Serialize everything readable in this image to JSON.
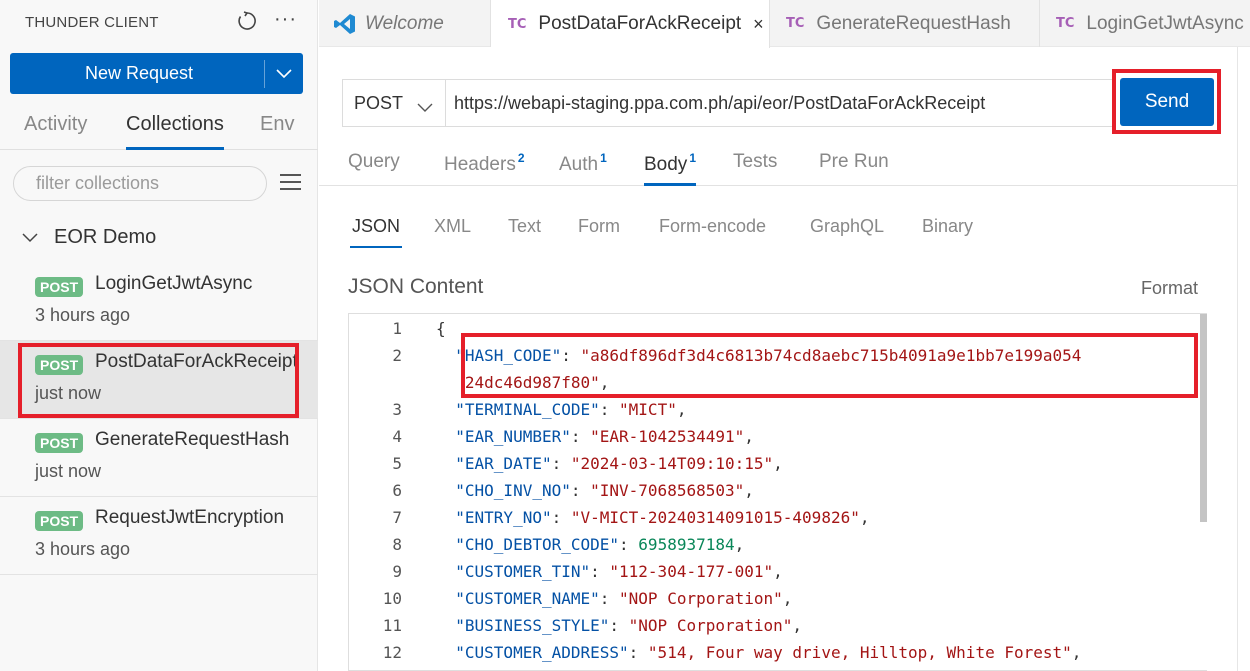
{
  "sidebar": {
    "title": "THUNDER CLIENT",
    "refresh_icon": "refresh-icon",
    "more_icon": "more-icon",
    "more_glyph": "···",
    "new_request_label": "New Request",
    "tabs": [
      {
        "label": "Activity",
        "active": false
      },
      {
        "label": "Collections",
        "active": true
      },
      {
        "label": "Env",
        "active": false
      }
    ],
    "filter_placeholder": "filter collections",
    "collection": {
      "name": "EOR Demo",
      "expanded": true
    },
    "requests": [
      {
        "method": "POST",
        "name": "LoginGetJwtAsync",
        "time": "3 hours ago",
        "selected": false
      },
      {
        "method": "POST",
        "name": "PostDataForAckReceipt",
        "time": "just now",
        "selected": true
      },
      {
        "method": "POST",
        "name": "GenerateRequestHash",
        "time": "just now",
        "selected": false
      },
      {
        "method": "POST",
        "name": "RequestJwtEncryption",
        "time": "3 hours ago",
        "selected": false
      }
    ]
  },
  "editor_tabs": [
    {
      "label": "Welcome",
      "icon": "vscode-icon",
      "active": false
    },
    {
      "label": "PostDataForAckReceipt",
      "icon": "tc",
      "active": true,
      "close": "×"
    },
    {
      "label": "GenerateRequestHash",
      "icon": "tc",
      "active": false
    },
    {
      "label": "LoginGetJwtAsync",
      "icon": "tc",
      "active": false
    }
  ],
  "tc_icon_text": "TC",
  "request": {
    "method": "POST",
    "url": "https://webapi-staging.ppa.com.ph/api/eor/PostDataForAckReceipt",
    "send_label": "Send",
    "tabs": [
      {
        "label": "Query",
        "count": ""
      },
      {
        "label": "Headers",
        "count": "2"
      },
      {
        "label": "Auth",
        "count": "1"
      },
      {
        "label": "Body",
        "count": "1",
        "active": true
      },
      {
        "label": "Tests",
        "count": ""
      },
      {
        "label": "Pre Run",
        "count": ""
      }
    ],
    "body_tabs": [
      "JSON",
      "XML",
      "Text",
      "Form",
      "Form-encode",
      "GraphQL",
      "Binary"
    ],
    "body_active": "JSON",
    "content_label": "JSON Content",
    "format_label": "Format"
  },
  "code_lines": [
    {
      "n": "1",
      "parts": [
        {
          "t": "{",
          "c": "p"
        }
      ]
    },
    {
      "n": "2",
      "parts": [
        {
          "t": "  \"HASH_CODE\"",
          "c": "k"
        },
        {
          "t": ": ",
          "c": "p"
        },
        {
          "t": "\"a86df896df3d4c6813b74cd8aebc715b4091a9e1bb7e199a054",
          "c": "s"
        }
      ]
    },
    {
      "n": "",
      "parts": [
        {
          "t": "   24dc46d987f80\"",
          "c": "s"
        },
        {
          "t": ",",
          "c": "p"
        }
      ]
    },
    {
      "n": "3",
      "parts": [
        {
          "t": "  \"TERMINAL_CODE\"",
          "c": "k"
        },
        {
          "t": ": ",
          "c": "p"
        },
        {
          "t": "\"MICT\"",
          "c": "s"
        },
        {
          "t": ",",
          "c": "p"
        }
      ]
    },
    {
      "n": "4",
      "parts": [
        {
          "t": "  \"EAR_NUMBER\"",
          "c": "k"
        },
        {
          "t": ": ",
          "c": "p"
        },
        {
          "t": "\"EAR-1042534491\"",
          "c": "s"
        },
        {
          "t": ",",
          "c": "p"
        }
      ]
    },
    {
      "n": "5",
      "parts": [
        {
          "t": "  \"EAR_DATE\"",
          "c": "k"
        },
        {
          "t": ": ",
          "c": "p"
        },
        {
          "t": "\"2024-03-14T09:10:15\"",
          "c": "s"
        },
        {
          "t": ",",
          "c": "p"
        }
      ]
    },
    {
      "n": "6",
      "parts": [
        {
          "t": "  \"CHO_INV_NO\"",
          "c": "k"
        },
        {
          "t": ": ",
          "c": "p"
        },
        {
          "t": "\"INV-7068568503\"",
          "c": "s"
        },
        {
          "t": ",",
          "c": "p"
        }
      ]
    },
    {
      "n": "7",
      "parts": [
        {
          "t": "  \"ENTRY_NO\"",
          "c": "k"
        },
        {
          "t": ": ",
          "c": "p"
        },
        {
          "t": "\"V-MICT-20240314091015-409826\"",
          "c": "s"
        },
        {
          "t": ",",
          "c": "p"
        }
      ]
    },
    {
      "n": "8",
      "parts": [
        {
          "t": "  \"CHO_DEBTOR_CODE\"",
          "c": "k"
        },
        {
          "t": ": ",
          "c": "p"
        },
        {
          "t": "6958937184",
          "c": "n"
        },
        {
          "t": ",",
          "c": "p"
        }
      ]
    },
    {
      "n": "9",
      "parts": [
        {
          "t": "  \"CUSTOMER_TIN\"",
          "c": "k"
        },
        {
          "t": ": ",
          "c": "p"
        },
        {
          "t": "\"112-304-177-001\"",
          "c": "s"
        },
        {
          "t": ",",
          "c": "p"
        }
      ]
    },
    {
      "n": "10",
      "parts": [
        {
          "t": "  \"CUSTOMER_NAME\"",
          "c": "k"
        },
        {
          "t": ": ",
          "c": "p"
        },
        {
          "t": "\"NOP Corporation\"",
          "c": "s"
        },
        {
          "t": ",",
          "c": "p"
        }
      ]
    },
    {
      "n": "11",
      "parts": [
        {
          "t": "  \"BUSINESS_STYLE\"",
          "c": "k"
        },
        {
          "t": ": ",
          "c": "p"
        },
        {
          "t": "\"NOP Corporation\"",
          "c": "s"
        },
        {
          "t": ",",
          "c": "p"
        }
      ]
    },
    {
      "n": "12",
      "parts": [
        {
          "t": "  \"CUSTOMER_ADDRESS\"",
          "c": "k"
        },
        {
          "t": ": ",
          "c": "p"
        },
        {
          "t": "\"514, Four way drive, Hilltop, White Forest\"",
          "c": "s"
        },
        {
          "t": ",",
          "c": "p"
        }
      ]
    }
  ],
  "colors": {
    "accent": "#0065be",
    "post_badge": "#6dbb85",
    "highlight": "#e51f2a",
    "tc_icon": "#a65fb6"
  }
}
